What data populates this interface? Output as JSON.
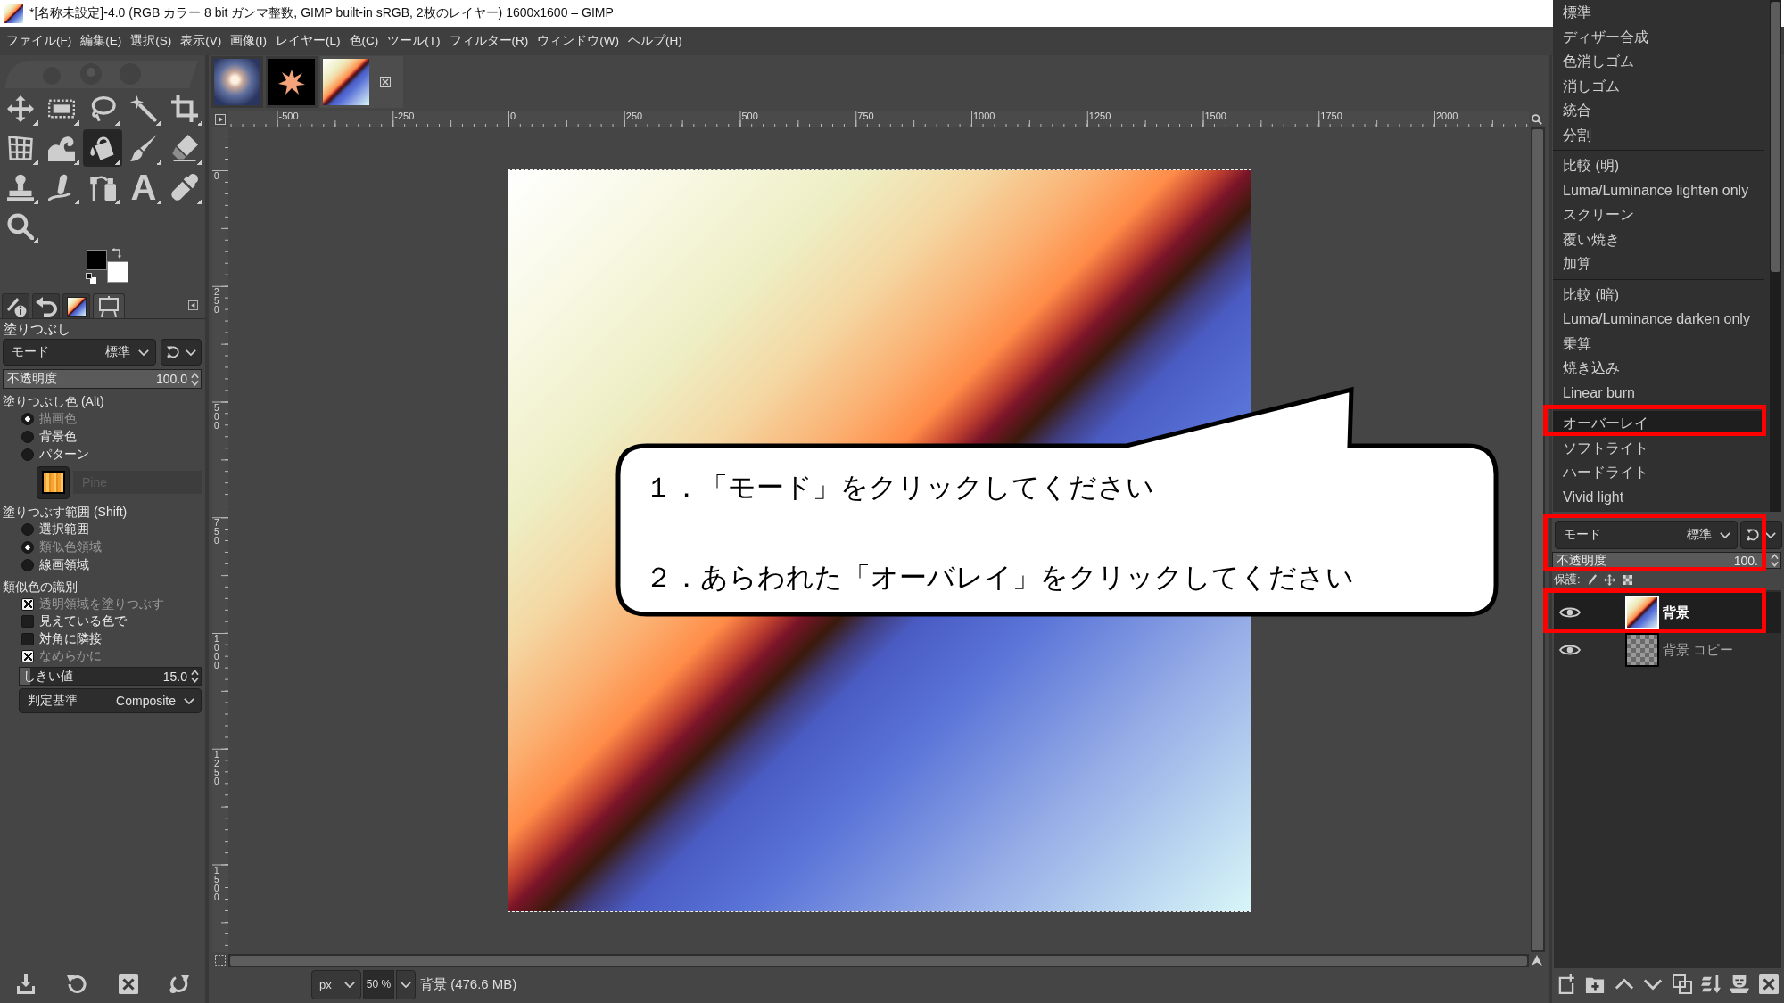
{
  "window": {
    "title": "*[名称未設定]-4.0 (RGB カラー 8 bit ガンマ整数, GIMP built-in sRGB, 2枚のレイヤー) 1600x1600 – GIMP"
  },
  "menu_bar": [
    "ファイル(F)",
    "編集(E)",
    "選択(S)",
    "表示(V)",
    "画像(I)",
    "レイヤー(L)",
    "色(C)",
    "ツール(T)",
    "フィルター(R)",
    "ウィンドウ(W)",
    "ヘルプ(H)"
  ],
  "toolbox": {
    "tools": [
      {
        "kind": "move",
        "selected": false
      },
      {
        "kind": "rect-select",
        "selected": false
      },
      {
        "kind": "free-select",
        "selected": false
      },
      {
        "kind": "fuzzy-select",
        "selected": false
      },
      {
        "kind": "crop",
        "selected": false
      },
      {
        "kind": "unified-transform",
        "selected": false
      },
      {
        "kind": "warp-transform",
        "selected": false
      },
      {
        "kind": "bucket-fill",
        "selected": true
      },
      {
        "kind": "paintbrush",
        "selected": false
      },
      {
        "kind": "eraser",
        "selected": false
      },
      {
        "kind": "clone",
        "selected": false
      },
      {
        "kind": "smudge",
        "selected": false
      },
      {
        "kind": "paths",
        "selected": false
      },
      {
        "kind": "text",
        "glyph": "A",
        "selected": false
      },
      {
        "kind": "color-picker",
        "selected": false
      },
      {
        "kind": "zoom",
        "selected": false
      }
    ],
    "colors": [
      {
        "kind": "foreground",
        "color": "#000000"
      },
      {
        "kind": "background",
        "color": "#ffffff"
      }
    ]
  },
  "dock_tabs": [
    {
      "kind": "device-status",
      "selected": false
    },
    {
      "kind": "undo-history",
      "selected": false
    },
    {
      "kind": "gradients",
      "selected": false
    },
    {
      "kind": "tool-options",
      "selected": true
    }
  ],
  "tool_options": {
    "title": "塗りつぶし",
    "mode": {
      "label": "モード",
      "value": "標準"
    },
    "opacity": {
      "label": "不透明度",
      "value": "100.0",
      "level": 1
    },
    "fill_type": {
      "label": "塗りつぶし色 (Alt)",
      "options": [
        {
          "label": "描画色",
          "selected": true
        },
        {
          "label": "背景色",
          "selected": false
        },
        {
          "label": "パターン",
          "selected": false
        }
      ],
      "pattern": {
        "name": "Pine",
        "disabled": true
      }
    },
    "fill_area": {
      "label": "塗りつぶす範囲 (Shift)",
      "options": [
        {
          "label": "選択範囲",
          "selected": false
        },
        {
          "label": "類似色領域",
          "selected": true
        },
        {
          "label": "線画領域",
          "selected": false
        }
      ]
    },
    "similar_colors": {
      "label": "類似色の識別",
      "options": [
        {
          "label": "透明領域を塗りつぶす",
          "checked": true
        },
        {
          "label": "見えている色で",
          "checked": false
        },
        {
          "label": "対角に隣接",
          "checked": false
        },
        {
          "label": "なめらかに",
          "checked": true
        }
      ],
      "threshold": {
        "label": "しきい値",
        "value": "15.0",
        "level": 0.06
      },
      "criterion": {
        "label": "判定基準",
        "value": "Composite"
      }
    },
    "buttons": [
      {
        "kind": "save"
      },
      {
        "kind": "reset"
      },
      {
        "kind": "delete"
      },
      {
        "kind": "restore"
      }
    ]
  },
  "image_tabs": [
    {
      "kind": "photo",
      "selected": false
    },
    {
      "kind": "star",
      "selected": false
    },
    {
      "kind": "gradient",
      "selected": true
    }
  ],
  "rulers": {
    "horizontal": [
      "-500",
      "-250",
      "0",
      "250",
      "500",
      "750",
      "1000",
      "1250",
      "1500",
      "1750",
      "2000"
    ],
    "vertical": [
      "0",
      "250",
      "500",
      "750",
      "1000",
      "1250",
      "1500"
    ]
  },
  "status_bar": {
    "unit": "px",
    "zoom": "50 %",
    "info": "背景 (476.6 MB)"
  },
  "mode_menu": {
    "sections": [
      {
        "items": [
          {
            "label": "標準",
            "selected": false
          },
          {
            "label": "ディザー合成",
            "selected": false
          },
          {
            "label": "色消しゴム",
            "selected": false
          },
          {
            "label": "消しゴム",
            "selected": false
          },
          {
            "label": "統合",
            "selected": false
          },
          {
            "label": "分割",
            "selected": false
          }
        ]
      },
      {
        "items": [
          {
            "label": "比較 (明)",
            "selected": false
          },
          {
            "label": "Luma/Luminance lighten only",
            "selected": false
          },
          {
            "label": "スクリーン",
            "selected": false
          },
          {
            "label": "覆い焼き",
            "selected": false
          },
          {
            "label": "加算",
            "selected": false
          }
        ]
      },
      {
        "items": [
          {
            "label": "比較 (暗)",
            "selected": false
          },
          {
            "label": "Luma/Luminance darken only",
            "selected": false
          },
          {
            "label": "乗算",
            "selected": false
          },
          {
            "label": "焼き込み",
            "selected": false
          },
          {
            "label": "Linear burn",
            "selected": false
          }
        ]
      },
      {
        "items": [
          {
            "label": "オーバーレイ",
            "selected": true
          },
          {
            "label": "ソフトライト",
            "selected": false
          },
          {
            "label": "ハードライト",
            "selected": false
          },
          {
            "label": "Vivid light",
            "selected": false
          }
        ]
      }
    ]
  },
  "layers_panel": {
    "mode": {
      "label": "モード",
      "value": "標準"
    },
    "opacity": {
      "label": "不透明度",
      "value": "100.",
      "level": 1
    },
    "lock_label": "保護:",
    "layers": [
      {
        "name": "背景",
        "kind": "gradient",
        "visible": true,
        "selected": true
      },
      {
        "name": "背景 コピー",
        "kind": "transparent",
        "visible": true,
        "selected": false
      }
    ],
    "buttons": [
      {
        "kind": "new-layer"
      },
      {
        "kind": "new-group"
      },
      {
        "kind": "raise"
      },
      {
        "kind": "lower"
      },
      {
        "kind": "duplicate"
      },
      {
        "kind": "merge"
      },
      {
        "kind": "mask"
      },
      {
        "kind": "delete"
      }
    ]
  },
  "callout": {
    "lines": [
      "１．「モード」をクリックしてください",
      "２．あらわれた「オーバレイ」をクリックしてください"
    ]
  }
}
